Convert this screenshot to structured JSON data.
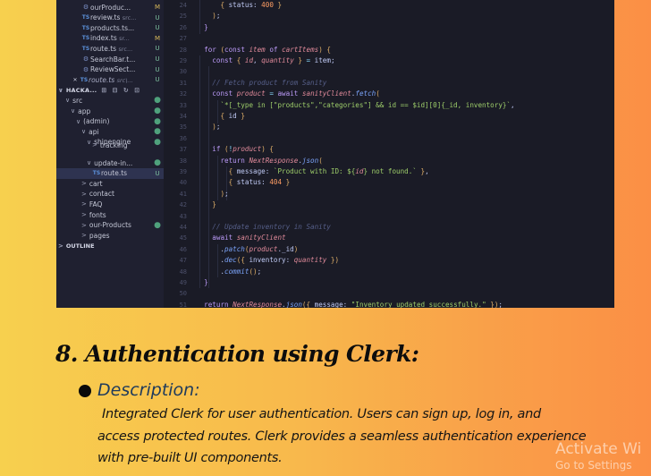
{
  "explorer": {
    "files": [
      {
        "icon": "⚙",
        "kind": "gear",
        "name": "ourProduc...",
        "sub": "",
        "status": "M"
      },
      {
        "icon": "TS",
        "kind": "ts",
        "name": "review.ts",
        "sub": "src...",
        "status": "U"
      },
      {
        "icon": "TS",
        "kind": "ts",
        "name": "products.ts...",
        "sub": "",
        "status": "U"
      },
      {
        "icon": "TS",
        "kind": "ts",
        "name": "index.ts",
        "sub": "sr...",
        "status": "M"
      },
      {
        "icon": "TS",
        "kind": "ts",
        "name": "route.ts",
        "sub": "src...",
        "status": "U"
      },
      {
        "icon": "⚙",
        "kind": "gear",
        "name": "SearchBar.t...",
        "sub": "",
        "status": "U"
      },
      {
        "icon": "⚙",
        "kind": "gear",
        "name": "ReviewSect...",
        "sub": "",
        "status": "U"
      }
    ],
    "active_file": {
      "close": "✕",
      "icon": "TS",
      "name": "route.ts",
      "sub": "src\\...",
      "status": "U"
    },
    "project": {
      "caret": "∨",
      "name": "HACKA...",
      "icons": "⊞ ⊟ ↻ ⊡"
    },
    "tree": [
      {
        "caret": "∨",
        "name": "src",
        "status": "●"
      },
      {
        "caret": "∨",
        "name": "app",
        "status": "●"
      },
      {
        "caret": "∨",
        "name": "(admin)",
        "status": "●"
      },
      {
        "caret": "∨",
        "name": "api",
        "status": "●"
      },
      {
        "caret": "∨",
        "name": "shipengine",
        "status": "●"
      },
      {
        "caret": ">",
        "name": "tracking",
        "status": ""
      },
      {
        "caret": "∨",
        "name": "update-in...",
        "status": "●"
      },
      {
        "caret": "",
        "name": "route.ts",
        "status": "U"
      },
      {
        "caret": ">",
        "name": "cart",
        "status": ""
      },
      {
        "caret": ">",
        "name": "contact",
        "status": ""
      },
      {
        "caret": ">",
        "name": "FAQ",
        "status": ""
      },
      {
        "caret": ">",
        "name": "fonts",
        "status": ""
      },
      {
        "caret": ">",
        "name": "our-Products",
        "status": "●"
      },
      {
        "caret": ">",
        "name": "pages",
        "status": ""
      }
    ],
    "outline": {
      "caret": ">",
      "label": "OUTLINE"
    }
  },
  "editor": {
    "line_numbers": [
      "24",
      "25",
      "26",
      "27",
      "28",
      "29",
      "30",
      "31",
      "32",
      "33",
      "34",
      "35",
      "36",
      "37",
      "38",
      "39",
      "40",
      "41",
      "42",
      "43",
      "44",
      "45",
      "46",
      "47",
      "48",
      "49",
      "50",
      "51"
    ]
  },
  "document": {
    "heading": "8. Authentication using Clerk:",
    "bullet_label": "Description:",
    "body_lines": [
      "Integrated Clerk for user authentication. Users can sign up, log in, and",
      "access protected routes. Clerk provides a seamless authentication experience",
      "with pre-built UI components."
    ]
  },
  "watermark": {
    "line1": "Activate Wi",
    "line2": "Go to Settings"
  },
  "colors": {
    "background_start": "#f7d04e",
    "background_end": "#fb8f45",
    "editor_bg": "#1a1b26",
    "explorer_bg": "#1f2030",
    "description_color": "#1e3a5c"
  }
}
